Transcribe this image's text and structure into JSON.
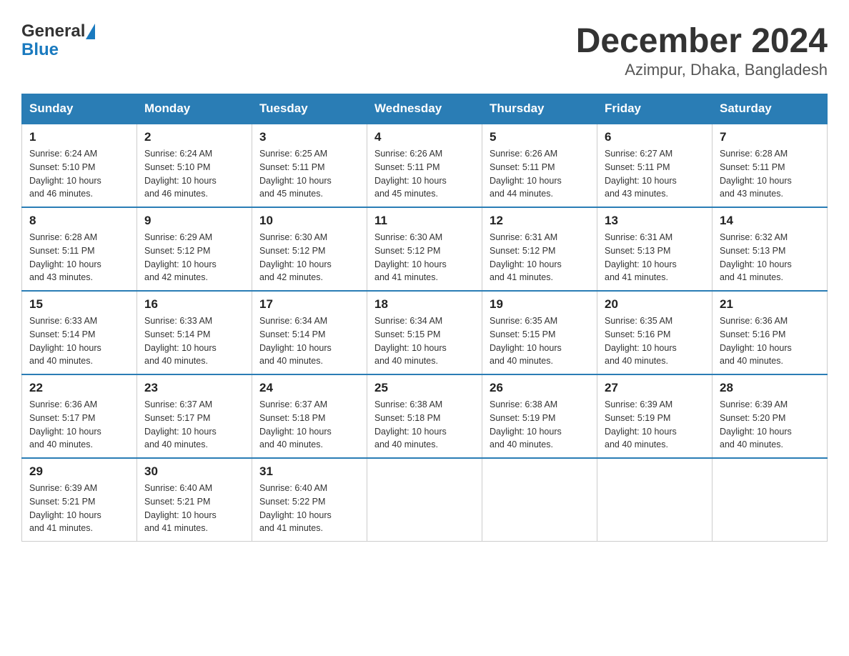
{
  "header": {
    "logo_general": "General",
    "logo_blue": "Blue",
    "title": "December 2024",
    "subtitle": "Azimpur, Dhaka, Bangladesh"
  },
  "weekdays": [
    "Sunday",
    "Monday",
    "Tuesday",
    "Wednesday",
    "Thursday",
    "Friday",
    "Saturday"
  ],
  "weeks": [
    [
      {
        "day": "1",
        "sunrise": "6:24 AM",
        "sunset": "5:10 PM",
        "daylight": "10 hours and 46 minutes."
      },
      {
        "day": "2",
        "sunrise": "6:24 AM",
        "sunset": "5:10 PM",
        "daylight": "10 hours and 46 minutes."
      },
      {
        "day": "3",
        "sunrise": "6:25 AM",
        "sunset": "5:11 PM",
        "daylight": "10 hours and 45 minutes."
      },
      {
        "day": "4",
        "sunrise": "6:26 AM",
        "sunset": "5:11 PM",
        "daylight": "10 hours and 45 minutes."
      },
      {
        "day": "5",
        "sunrise": "6:26 AM",
        "sunset": "5:11 PM",
        "daylight": "10 hours and 44 minutes."
      },
      {
        "day": "6",
        "sunrise": "6:27 AM",
        "sunset": "5:11 PM",
        "daylight": "10 hours and 43 minutes."
      },
      {
        "day": "7",
        "sunrise": "6:28 AM",
        "sunset": "5:11 PM",
        "daylight": "10 hours and 43 minutes."
      }
    ],
    [
      {
        "day": "8",
        "sunrise": "6:28 AM",
        "sunset": "5:11 PM",
        "daylight": "10 hours and 43 minutes."
      },
      {
        "day": "9",
        "sunrise": "6:29 AM",
        "sunset": "5:12 PM",
        "daylight": "10 hours and 42 minutes."
      },
      {
        "day": "10",
        "sunrise": "6:30 AM",
        "sunset": "5:12 PM",
        "daylight": "10 hours and 42 minutes."
      },
      {
        "day": "11",
        "sunrise": "6:30 AM",
        "sunset": "5:12 PM",
        "daylight": "10 hours and 41 minutes."
      },
      {
        "day": "12",
        "sunrise": "6:31 AM",
        "sunset": "5:12 PM",
        "daylight": "10 hours and 41 minutes."
      },
      {
        "day": "13",
        "sunrise": "6:31 AM",
        "sunset": "5:13 PM",
        "daylight": "10 hours and 41 minutes."
      },
      {
        "day": "14",
        "sunrise": "6:32 AM",
        "sunset": "5:13 PM",
        "daylight": "10 hours and 41 minutes."
      }
    ],
    [
      {
        "day": "15",
        "sunrise": "6:33 AM",
        "sunset": "5:14 PM",
        "daylight": "10 hours and 40 minutes."
      },
      {
        "day": "16",
        "sunrise": "6:33 AM",
        "sunset": "5:14 PM",
        "daylight": "10 hours and 40 minutes."
      },
      {
        "day": "17",
        "sunrise": "6:34 AM",
        "sunset": "5:14 PM",
        "daylight": "10 hours and 40 minutes."
      },
      {
        "day": "18",
        "sunrise": "6:34 AM",
        "sunset": "5:15 PM",
        "daylight": "10 hours and 40 minutes."
      },
      {
        "day": "19",
        "sunrise": "6:35 AM",
        "sunset": "5:15 PM",
        "daylight": "10 hours and 40 minutes."
      },
      {
        "day": "20",
        "sunrise": "6:35 AM",
        "sunset": "5:16 PM",
        "daylight": "10 hours and 40 minutes."
      },
      {
        "day": "21",
        "sunrise": "6:36 AM",
        "sunset": "5:16 PM",
        "daylight": "10 hours and 40 minutes."
      }
    ],
    [
      {
        "day": "22",
        "sunrise": "6:36 AM",
        "sunset": "5:17 PM",
        "daylight": "10 hours and 40 minutes."
      },
      {
        "day": "23",
        "sunrise": "6:37 AM",
        "sunset": "5:17 PM",
        "daylight": "10 hours and 40 minutes."
      },
      {
        "day": "24",
        "sunrise": "6:37 AM",
        "sunset": "5:18 PM",
        "daylight": "10 hours and 40 minutes."
      },
      {
        "day": "25",
        "sunrise": "6:38 AM",
        "sunset": "5:18 PM",
        "daylight": "10 hours and 40 minutes."
      },
      {
        "day": "26",
        "sunrise": "6:38 AM",
        "sunset": "5:19 PM",
        "daylight": "10 hours and 40 minutes."
      },
      {
        "day": "27",
        "sunrise": "6:39 AM",
        "sunset": "5:19 PM",
        "daylight": "10 hours and 40 minutes."
      },
      {
        "day": "28",
        "sunrise": "6:39 AM",
        "sunset": "5:20 PM",
        "daylight": "10 hours and 40 minutes."
      }
    ],
    [
      {
        "day": "29",
        "sunrise": "6:39 AM",
        "sunset": "5:21 PM",
        "daylight": "10 hours and 41 minutes."
      },
      {
        "day": "30",
        "sunrise": "6:40 AM",
        "sunset": "5:21 PM",
        "daylight": "10 hours and 41 minutes."
      },
      {
        "day": "31",
        "sunrise": "6:40 AM",
        "sunset": "5:22 PM",
        "daylight": "10 hours and 41 minutes."
      },
      null,
      null,
      null,
      null
    ]
  ],
  "labels": {
    "sunrise": "Sunrise:",
    "sunset": "Sunset:",
    "daylight": "Daylight:"
  }
}
